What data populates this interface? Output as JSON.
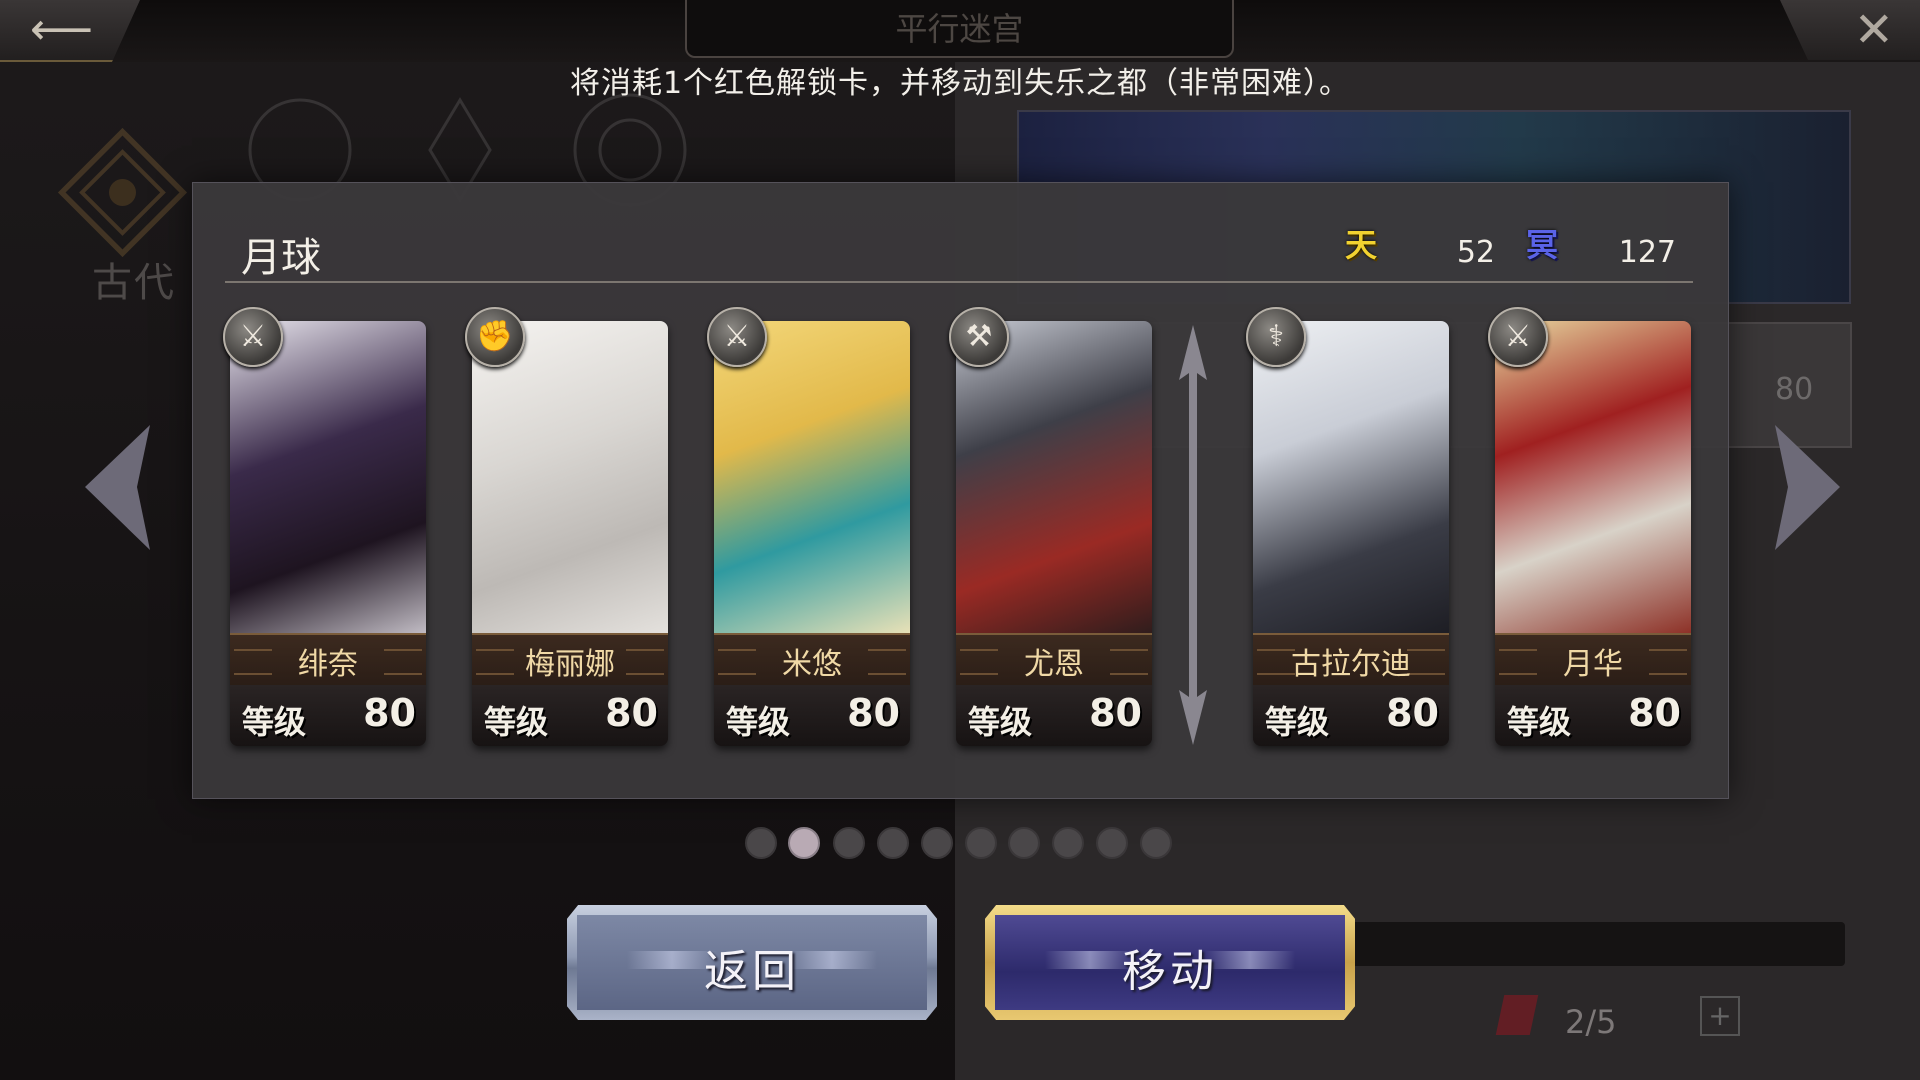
{
  "screen_title": "平行迷宫",
  "notice": "将消耗1个红色解锁卡，并移动到失乐之都（非常困难）。",
  "background": {
    "era_label": "古代",
    "right_level": "80",
    "right_count": "2/5"
  },
  "dialog": {
    "team_name": "月球",
    "sky_icon": "天",
    "sky_value": "52",
    "dark_icon": "冥",
    "dark_value": "127",
    "level_label": "等级",
    "cards": [
      {
        "name": "绯奈",
        "level": "80",
        "weapon": "sword-icon"
      },
      {
        "name": "梅丽娜",
        "level": "80",
        "weapon": "fist-icon"
      },
      {
        "name": "米悠",
        "level": "80",
        "weapon": "sword-icon"
      },
      {
        "name": "尤恩",
        "level": "80",
        "weapon": "hammer-icon"
      },
      {
        "name": "古拉尔迪",
        "level": "80",
        "weapon": "staff-icon"
      },
      {
        "name": "月华",
        "level": "80",
        "weapon": "katana-icon"
      }
    ]
  },
  "pagination": {
    "total": 10,
    "active": 2
  },
  "buttons": {
    "back_label": "返回",
    "move_label": "移动"
  },
  "colors": {
    "sky": "#f2d230",
    "dark": "#5a63e8",
    "nameplate_text": "#f0d9a6"
  }
}
